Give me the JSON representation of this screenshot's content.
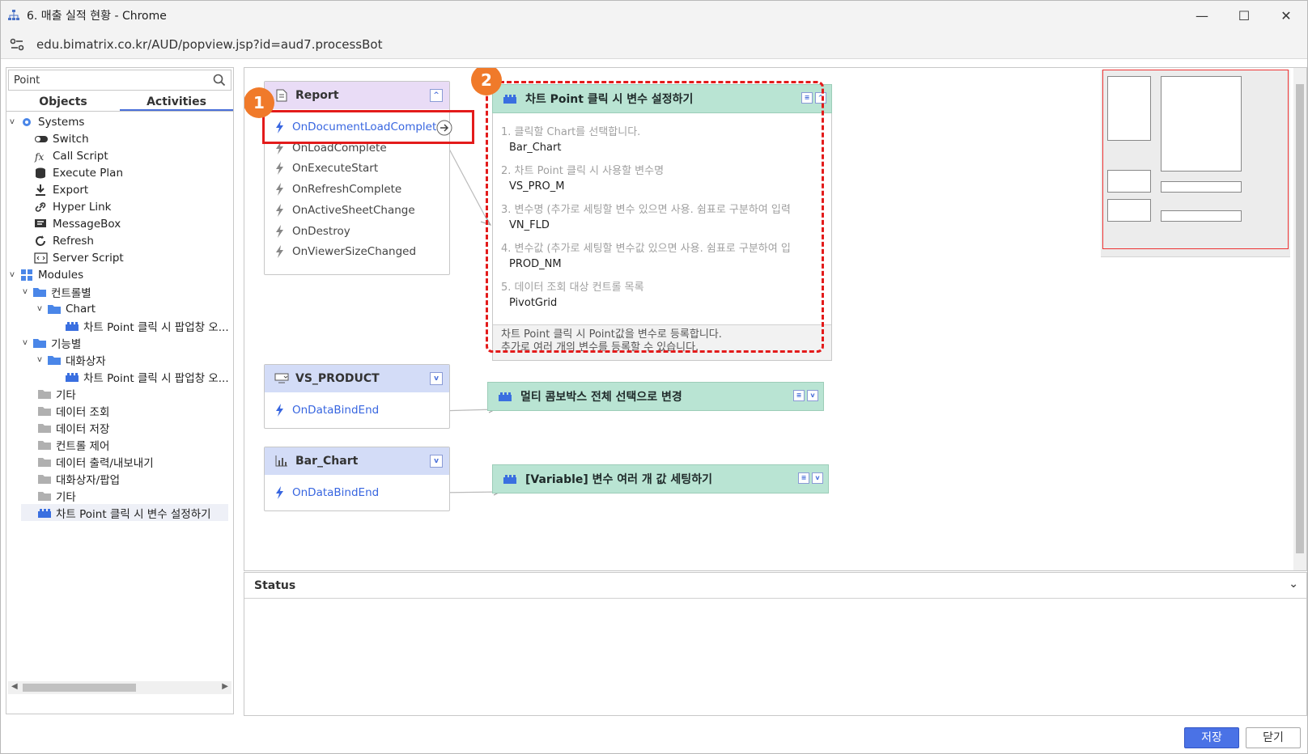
{
  "window": {
    "title": "6. 매출 실적 현황 - Chrome",
    "url": "edu.bimatrix.co.kr/AUD/popview.jsp?id=aud7.processBot",
    "minimize": "—",
    "maximize": "☐",
    "close": "✕"
  },
  "left_panel": {
    "search_value": "Point",
    "tabs": [
      "Objects",
      "Activities"
    ],
    "active_tab": "Activities",
    "tree": [
      {
        "label": "Systems",
        "icon": "gear-icon"
      },
      {
        "label": "Switch",
        "icon": "toggle-icon"
      },
      {
        "label": "Call Script",
        "icon": "fx-icon"
      },
      {
        "label": "Execute Plan",
        "icon": "database-icon"
      },
      {
        "label": "Export",
        "icon": "download-icon"
      },
      {
        "label": "Hyper Link",
        "icon": "link-icon"
      },
      {
        "label": "MessageBox",
        "icon": "message-icon"
      },
      {
        "label": "Refresh",
        "icon": "refresh-icon"
      },
      {
        "label": "Server Script",
        "icon": "code-icon"
      },
      {
        "label": "Modules",
        "icon": "grid-icon"
      },
      {
        "label": "컨트롤별",
        "icon": "folder-icon"
      },
      {
        "label": "Chart",
        "icon": "folder-icon"
      },
      {
        "label": "차트 Point 클릭 시 팝업창 오...",
        "icon": "block-icon"
      },
      {
        "label": "기능별",
        "icon": "folder-icon"
      },
      {
        "label": "대화상자",
        "icon": "folder-icon"
      },
      {
        "label": "차트 Point 클릭 시 팝업창 오...",
        "icon": "block-icon"
      },
      {
        "label": "기타",
        "icon": "folder-icon"
      },
      {
        "label": "데이터 조회",
        "icon": "folder-icon"
      },
      {
        "label": "데이터 저장",
        "icon": "folder-icon"
      },
      {
        "label": "컨트롤 제어",
        "icon": "folder-icon"
      },
      {
        "label": "데이터 출력/내보내기",
        "icon": "folder-icon"
      },
      {
        "label": "대화상자/팝업",
        "icon": "folder-icon"
      },
      {
        "label": "기타",
        "icon": "folder-icon"
      },
      {
        "label": "차트 Point 클릭 시 변수 설정하기",
        "icon": "block-icon"
      }
    ]
  },
  "canvas": {
    "report_node": {
      "title": "Report",
      "events": [
        "OnDocumentLoadComplete",
        "OnLoadComplete",
        "OnExecuteStart",
        "OnRefreshComplete",
        "OnActiveSheetChange",
        "OnDestroy",
        "OnViewerSizeChanged"
      ]
    },
    "vs_product_node": {
      "title": "VS_PRODUCT",
      "events": [
        "OnDataBindEnd"
      ]
    },
    "bar_chart_node": {
      "title": "Bar_Chart",
      "events": [
        "OnDataBindEnd"
      ]
    },
    "action_main": {
      "title": "차트 Point 클릭 시 변수 설정하기",
      "params": [
        {
          "q": "1. 클릭할 Chart를 선택합니다.",
          "v": "Bar_Chart"
        },
        {
          "q": "2. 차트 Point 클릭 시 사용할 변수명",
          "v": "VS_PRO_M"
        },
        {
          "q": "3. 변수명 (추가로 세팅할 변수 있으면 사용. 쉼표로 구분하여 입력",
          "v": "VN_FLD"
        },
        {
          "q": "4. 변수값 (추가로 세팅할 변수값 있으면 사용. 쉼표로 구분하여 입",
          "v": "PROD_NM"
        },
        {
          "q": "5. 데이터 조회 대상 컨트롤 목록",
          "v": "PivotGrid"
        }
      ],
      "footer_1": "차트 Point 클릭 시 Point값을 변수로 등록합니다.",
      "footer_2": "추가로  여러 개의 변수를 등록할 수 있습니다."
    },
    "action_multi": {
      "title": "멀티 콤보박스 전체 선택으로 변경"
    },
    "action_variable": {
      "title": "[Variable] 변수 여러 개 값 세팅하기"
    },
    "badges": [
      "1",
      "2"
    ]
  },
  "status": {
    "title": "Status"
  },
  "buttons": {
    "save": "저장",
    "close": "닫기"
  },
  "colors": {
    "accent": "#4a72e6",
    "activity": "#b9e4d3",
    "annotation": "#e31b1b",
    "badge": "#f07a2a"
  }
}
